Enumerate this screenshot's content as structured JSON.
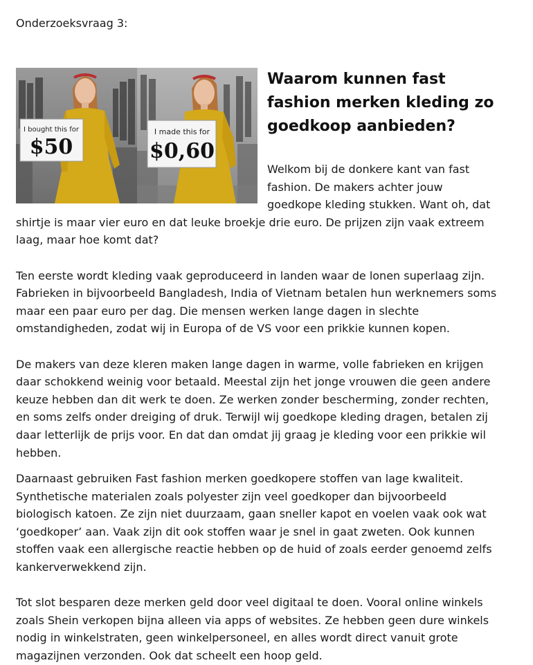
{
  "research_question_label": "Onderzoeksvraag 3:",
  "title": "Waarom kunnen fast fashion merken kleding zo goedkoop aanbieden?",
  "image": {
    "left_sign_top": "I bought this for",
    "left_sign_price": "$50",
    "right_sign_top": "I made this for",
    "right_sign_price": "$0,60",
    "dress_color": "#d4a91a"
  },
  "paragraphs": [
    "Welkom bij de donkere kant van fast fashion. De makers achter jouw goedkope kleding stukken. Want oh, dat shirtje is maar vier euro en dat leuke broekje drie euro. De prijzen zijn vaak extreem laag, maar hoe komt dat?",
    "Ten eerste wordt kleding vaak geproduceerd in landen waar de lonen superlaag zijn. Fabrieken in bijvoorbeeld Bangladesh, India of Vietnam betalen hun werknemers soms maar een paar euro per dag. Die mensen werken lange dagen in slechte omstandigheden, zodat wij in Europa of de VS voor een prikkie kunnen kopen.",
    "De makers van deze kleren maken lange dagen in warme, volle fabrieken en krijgen daar schokkend weinig voor betaald. Meestal zijn het jonge vrouwen die geen andere keuze hebben dan dit werk te doen. Ze werken zonder bescherming, zonder rechten, en soms zelfs onder dreiging of druk. Terwijl wij goedkope kleding dragen, betalen zij daar letterlijk de prijs voor. En dat dan omdat jij graag je kleding voor een prikkie wil hebben.",
    "Daarnaast gebruiken Fast fashion merken goedkopere stoffen van lage kwaliteit. Synthetische materialen zoals polyester zijn veel goedkoper dan bijvoorbeeld biologisch katoen. Ze zijn niet duurzaam, gaan sneller kapot en voelen vaak ook wat ‘goedkoper’ aan. Vaak zijn dit ook stoffen waar je snel in gaat zweten. Ook kunnen stoffen vaak een allergische reactie hebben op de huid of zoals eerder genoemd zelfs kankerverwekkend zijn.",
    "Tot slot besparen deze merken geld door veel digitaal te doen. Vooral online winkels zoals Shein verkopen bijna alleen via apps of websites. Ze hebben geen dure winkels nodig in winkelstraten, geen winkelpersoneel, en alles wordt direct vanuit grote magazijnen verzonden. Ook dat scheelt een hoop geld."
  ]
}
